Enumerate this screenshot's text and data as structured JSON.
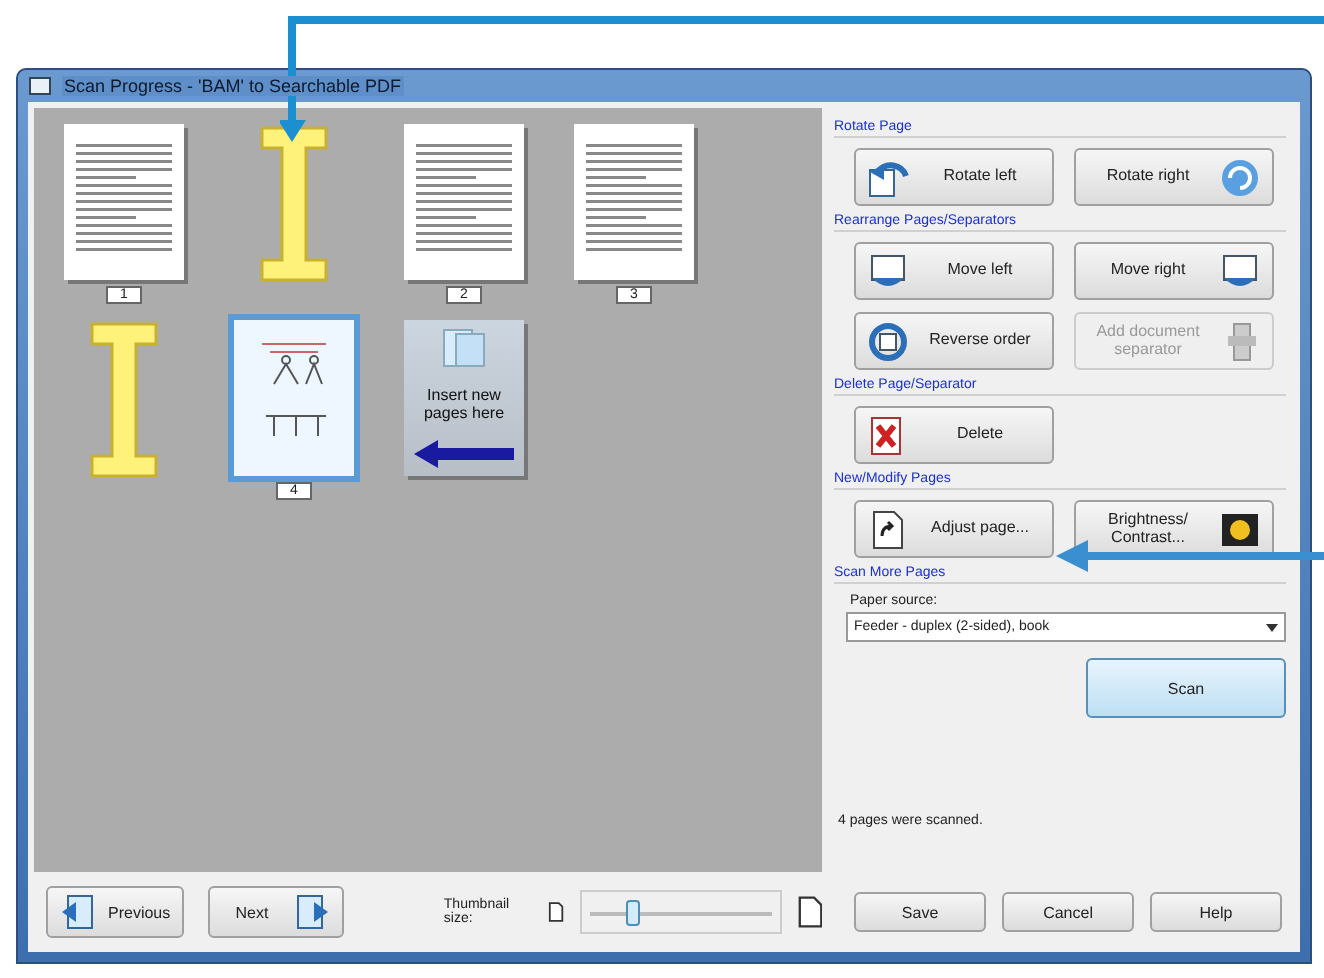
{
  "window": {
    "title": "Scan Progress - 'BAM' to Searchable PDF"
  },
  "thumbnails": [
    {
      "kind": "page",
      "label": "1",
      "selected": false
    },
    {
      "kind": "separator",
      "selected": false
    },
    {
      "kind": "page",
      "label": "2",
      "selected": false
    },
    {
      "kind": "page",
      "label": "3",
      "selected": false
    },
    {
      "kind": "separator",
      "selected": false
    },
    {
      "kind": "page",
      "label": "4",
      "selected": true
    },
    {
      "kind": "insert",
      "text": "Insert new pages here",
      "selected": false
    }
  ],
  "sections": [
    {
      "title": "Rotate Page",
      "buttons": [
        {
          "label": "Rotate left",
          "disabled": false
        },
        {
          "label": "Rotate right",
          "disabled": false
        }
      ]
    },
    {
      "title": "Rearrange Pages/Separators",
      "buttons": [
        {
          "label": "Move left",
          "disabled": false
        },
        {
          "label": "Move right",
          "disabled": false
        },
        {
          "label": "Reverse order",
          "disabled": false
        },
        {
          "label": "Add document separator",
          "disabled": true
        }
      ]
    },
    {
      "title": "Delete Page/Separator",
      "buttons": [
        {
          "label": "Delete",
          "disabled": false
        }
      ]
    },
    {
      "title": "New/Modify Pages",
      "buttons": [
        {
          "label": "Adjust page...",
          "disabled": false
        },
        {
          "label": "Brightness/ Contrast...",
          "disabled": false
        }
      ]
    },
    {
      "title": "Scan More Pages"
    }
  ],
  "paper_source": {
    "label": "Paper source:",
    "value": "Feeder - duplex (2-sided), book"
  },
  "scan_button": "Scan",
  "status": "4 pages were scanned.",
  "footer": {
    "previous": "Previous",
    "next": "Next",
    "thumbnail_size": {
      "label": "Thumbnail size:",
      "level": 0.25
    },
    "buttons": [
      "Save",
      "Cancel",
      "Help"
    ]
  }
}
